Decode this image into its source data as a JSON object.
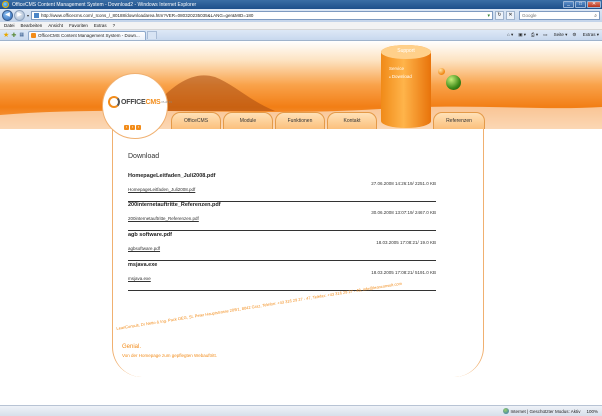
{
  "window": {
    "title": "OfficeCMS Content Management System - Download2 - Windows Internet Explorer",
    "minimize": "_",
    "maximize": "□",
    "close": "✕"
  },
  "address": {
    "url": "http://www.officecms.com/_Icons_/_80188/downloadarea.htm?VER=080320235035&LANG=ger&MID=180",
    "search_placeholder": "Google"
  },
  "menu": [
    "Datei",
    "Bearbeiten",
    "Ansicht",
    "Favoriten",
    "Extras",
    "?"
  ],
  "tab": {
    "label": "OfficeCMS Content Management System - Down..."
  },
  "tabtools": {
    "page": "Seite",
    "extras": "Extras"
  },
  "site": {
    "logo_main": "OFFICE",
    "logo_accent": "CMS",
    "logo_sub": "PLATIN",
    "support_label": "Support",
    "support_items": [
      "Service",
      "Download"
    ],
    "nav": [
      "OfficeCMS",
      "Module",
      "Funktionen",
      "Kontakt",
      "Referenzen"
    ],
    "heading": "Download",
    "downloads": [
      {
        "name": "HomepageLeitfaden_Juli2008.pdf",
        "link": "HomepageLeitfaden_Juli2008.pdf",
        "meta": "27.06.2008 14:26:19/  2251.0 KB"
      },
      {
        "name": "200internetauftritte_Referenzen.pdf",
        "link": "200internetauftritte_Referenzen.pdf",
        "meta": "30.06.2008 13:07:19/  2467.0 KB"
      },
      {
        "name": "agb software.pdf",
        "link": "agbsoftware.pdf",
        "meta": "18.03.2005 17:08:21/  19.0 KB"
      },
      {
        "name": "msjava.exe",
        "link": "msjava.exe",
        "meta": "18.03.2005 17:08:21/  5191.0 KB"
      }
    ],
    "footer_address": "LeanConsult, Dr Netto & Ing. Pack OEG, St. Peter Hauptstrasse 209/1, 8042 Graz, Telefon: +43 316 29 27 - 47, Telefax: +43 316 29 27 - 48, info@leanconsult.com",
    "genial": "Genial.",
    "genial_sub": "Von der Homepage zum gepflegten Webauftritt."
  },
  "status": {
    "zone": "Internet | Geschützter Modus: Aktiv",
    "zoom": "100%"
  },
  "colors": {
    "accent": "#f28c1a",
    "ie_blue": "#2a64b4"
  }
}
